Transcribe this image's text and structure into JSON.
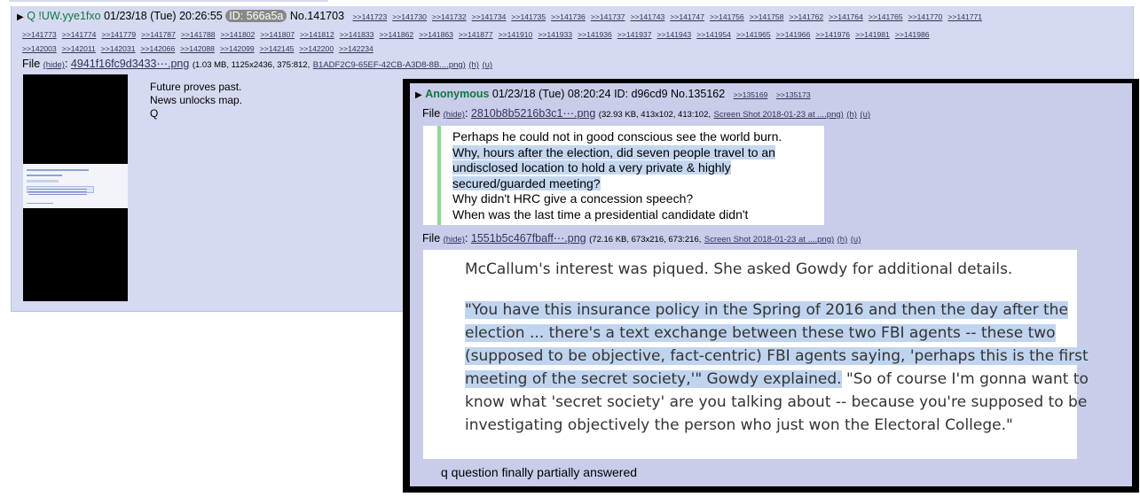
{
  "post": {
    "name": "Q",
    "trip": "!UW.yye1fxo",
    "datetime": "01/23/18 (Tue) 20:26:55",
    "id_badge": "ID: 566a5a",
    "number": "No.141703",
    "quotelinks_row1": [
      ">>141723",
      ">>141730",
      ">>141732",
      ">>141734",
      ">>141735",
      ">>141736",
      ">>141737",
      ">>141743",
      ">>141747",
      ">>141756",
      ">>141758",
      ">>141762",
      ">>141764",
      ">>141765",
      ">>141770",
      ">>141771"
    ],
    "quotelinks_row2": [
      ">>141773",
      ">>141774",
      ">>141779",
      ">>141787",
      ">>141788",
      ">>141802",
      ">>141807",
      ">>141812",
      ">>141833",
      ">>141862",
      ">>141863",
      ">>141877",
      ">>141910",
      ">>141933",
      ">>141936",
      ">>141937",
      ">>141943",
      ">>141954",
      ">>141965",
      ">>141966",
      ">>141976",
      ">>141981",
      ">>141986"
    ],
    "quotelinks_row3": [
      ">>142003",
      ">>142011",
      ">>142031",
      ">>142066",
      ">>142088",
      ">>142099",
      ">>142145",
      ">>142200",
      ">>142234"
    ],
    "file_label": "File",
    "hide_label": "(hide)",
    "file_name": "4941f16fc9d3433⋯.png",
    "file_meta": "(1.03 MB, 1125x2436, 375:812,",
    "file_orig": "B1ADF2C9-65EF-42CB-A3D8-8B....png)",
    "file_h": "(h)",
    "file_u": "(u)",
    "message_lines": [
      "Future proves past.",
      "News unlocks map.",
      "Q"
    ]
  },
  "overlay": {
    "name": "Anonymous",
    "datetime": "01/23/18 (Tue) 08:20:24",
    "id": "ID: d96cd9",
    "number": "No.135162",
    "replies": [
      ">>135169",
      ">>135173"
    ],
    "file1": {
      "label": "File",
      "hide": "(hide)",
      "name": "2810b8b5216b3c1⋯.png",
      "meta": "(32.93 KB, 413x102, 413:102,",
      "orig": "Screen Shot 2018-01-23 at ....png)",
      "h": "(h)",
      "u": "(u)"
    },
    "image1_lines": [
      "Perhaps he could not in good conscious see the world burn.",
      "Why, hours after the election, did seven people travel to an",
      "undisclosed location to hold a very private & highly",
      "secured/guarded meeting?",
      "Why didn't HRC give a concession speech?",
      "When was the last time a presidential candidate didn't"
    ],
    "file2": {
      "label": "File",
      "hide": "(hide)",
      "name": "1551b5c467fbaff⋯.png",
      "meta": "(72.16 KB, 673x216, 673:216,",
      "orig": "Screen Shot 2018-01-23 at ....png)",
      "h": "(h)",
      "u": "(u)"
    },
    "image2_lead": "McCallum's interest was piqued. She asked Gowdy for additional details.",
    "image2_quote_lines": [
      "\"You have this insurance policy in the Spring of 2016 and then the day after the",
      "election  ... there's a text exchange between these two FBI agents -- these two",
      "(supposed to be objective, fact-centric) FBI agents saying, 'perhaps this is the first",
      "meeting of the secret society,'\" Gowdy explained."
    ],
    "image2_tail_on_line4": " \"So of course I'm gonna want to",
    "image2_after_lines": [
      "know what 'secret society' are you talking about -- because you're supposed to be",
      "investigating objectively the person who just won the Electoral College.\""
    ],
    "caption": "q question finally partially answered"
  }
}
